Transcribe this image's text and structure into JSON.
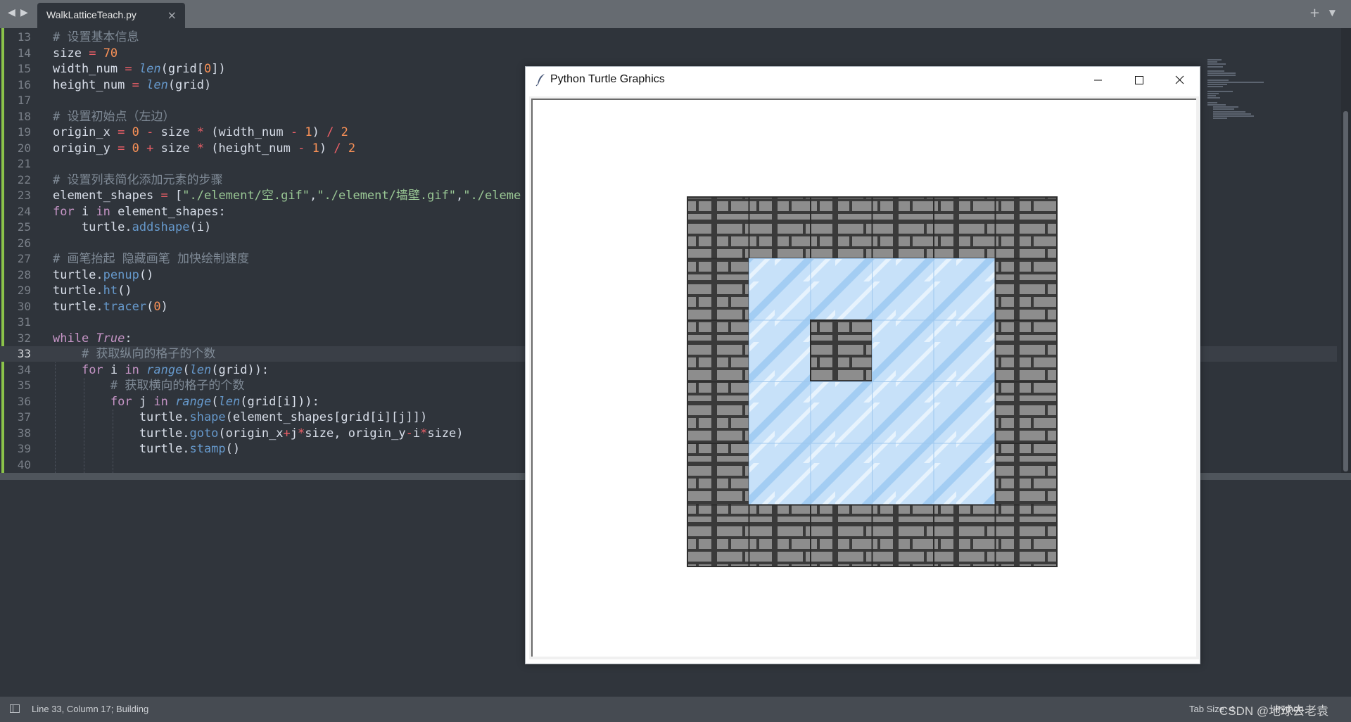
{
  "tabbar": {
    "back": "◀",
    "forward": "▶",
    "tab_label": "WalkLatticeTeach.py",
    "close": "×",
    "new_tab": "+",
    "menu": "▼"
  },
  "editor": {
    "lines": [
      {
        "n": "13",
        "html": "<span class=\"c\"># 设置基本信息</span>"
      },
      {
        "n": "14",
        "html": "size <span class=\"o\">=</span> <span class=\"n\">70</span>"
      },
      {
        "n": "15",
        "html": "width_num <span class=\"o\">=</span> <span class=\"fi\">len</span>(grid[<span class=\"n\">0</span>])"
      },
      {
        "n": "16",
        "html": "height_num <span class=\"o\">=</span> <span class=\"fi\">len</span>(grid)"
      },
      {
        "n": "17",
        "html": ""
      },
      {
        "n": "18",
        "html": "<span class=\"c\"># 设置初始点（左边）</span>"
      },
      {
        "n": "19",
        "html": "origin_x <span class=\"o\">=</span> <span class=\"n\">0</span> <span class=\"o\">-</span> size <span class=\"o\">*</span> (width_num <span class=\"o\">-</span> <span class=\"n\">1</span>) <span class=\"o\">/</span> <span class=\"n\">2</span>"
      },
      {
        "n": "20",
        "html": "origin_y <span class=\"o\">=</span> <span class=\"n\">0</span> <span class=\"o\">+</span> size <span class=\"o\">*</span> (height_num <span class=\"o\">-</span> <span class=\"n\">1</span>) <span class=\"o\">/</span> <span class=\"n\">2</span>"
      },
      {
        "n": "21",
        "html": ""
      },
      {
        "n": "22",
        "html": "<span class=\"c\"># 设置列表简化添加元素的步骤</span>"
      },
      {
        "n": "23",
        "html": "element_shapes <span class=\"o\">=</span> [<span class=\"s\">\"./element/空.gif\"</span>,<span class=\"s\">\"./element/墙壁.gif\"</span>,<span class=\"s\">\"./eleme</span>"
      },
      {
        "n": "24",
        "html": "<span class=\"k\">for</span> i <span class=\"k\">in</span> element_shapes:"
      },
      {
        "n": "25",
        "html": "    turtle.<span class=\"f\">addshape</span>(i)"
      },
      {
        "n": "26",
        "html": ""
      },
      {
        "n": "27",
        "html": "<span class=\"c\"># 画笔抬起 隐藏画笔 加快绘制速度</span>"
      },
      {
        "n": "28",
        "html": "turtle.<span class=\"f\">penup</span>()"
      },
      {
        "n": "29",
        "html": "turtle.<span class=\"f\">ht</span>()"
      },
      {
        "n": "30",
        "html": "turtle.<span class=\"f\">tracer</span>(<span class=\"n\">0</span>)"
      },
      {
        "n": "31",
        "html": ""
      },
      {
        "n": "32",
        "html": "<span class=\"k\">while</span> <span class=\"b\">True</span>:"
      },
      {
        "n": "33",
        "html": "    <span class=\"c\"># 获取纵向的格子的个数</span>",
        "current": true
      },
      {
        "n": "34",
        "html": "    <span class=\"k\">for</span> i <span class=\"k\">in</span> <span class=\"fi\">range</span>(<span class=\"fi\">len</span>(grid)):"
      },
      {
        "n": "35",
        "html": "        <span class=\"c\"># 获取横向的格子的个数</span>"
      },
      {
        "n": "36",
        "html": "        <span class=\"k\">for</span> j <span class=\"k\">in</span> <span class=\"fi\">range</span>(<span class=\"fi\">len</span>(grid[i])):"
      },
      {
        "n": "37",
        "html": "            turtle.<span class=\"f\">shape</span>(element_shapes[grid[i][j]])"
      },
      {
        "n": "38",
        "html": "            turtle.<span class=\"f\">goto</span>(origin_x<span class=\"o\">+</span>j<span class=\"o\">*</span>size, origin_y<span class=\"o\">-</span>i<span class=\"o\">*</span>size)"
      },
      {
        "n": "39",
        "html": "            turtle.<span class=\"f\">stamp</span>()"
      },
      {
        "n": "40",
        "html": ""
      }
    ]
  },
  "turtle_window": {
    "title": "Python Turtle Graphics",
    "grid": [
      [
        1,
        1,
        1,
        1,
        1,
        1
      ],
      [
        1,
        0,
        0,
        0,
        0,
        1
      ],
      [
        1,
        0,
        1,
        0,
        0,
        1
      ],
      [
        1,
        0,
        0,
        0,
        0,
        1
      ],
      [
        1,
        0,
        0,
        0,
        0,
        1
      ],
      [
        1,
        1,
        1,
        1,
        1,
        1
      ]
    ],
    "colors": {
      "wall": "#8a8a8a",
      "wall_dark": "#3a3a3a",
      "glass": "#bcdcf7",
      "glass_stripe": "#a3cdf3"
    }
  },
  "statusbar": {
    "position_text": "Line 33, Column 17; Building",
    "tab_size": "Tab Size: 4",
    "syntax": "Python",
    "watermark": "CSDN @地球去老袁"
  }
}
